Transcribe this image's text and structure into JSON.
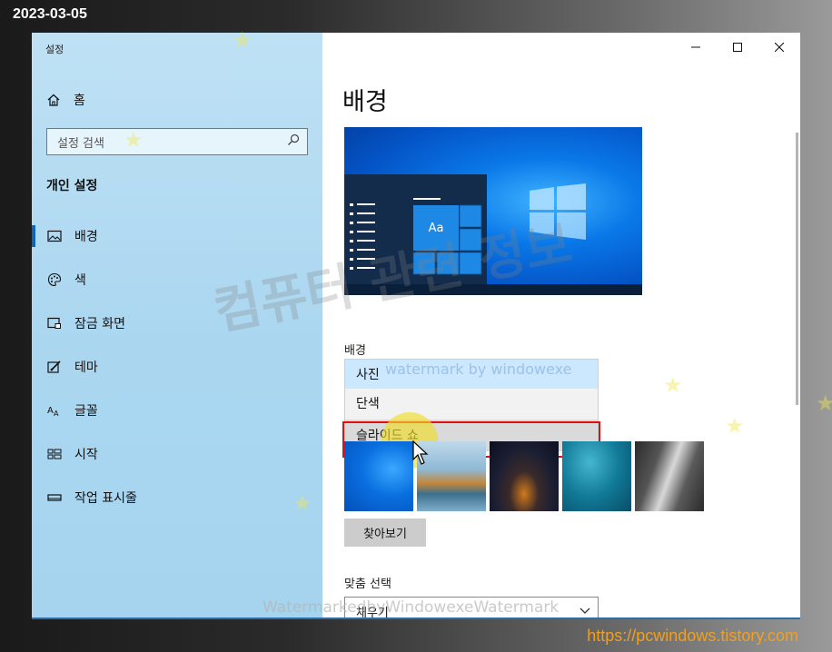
{
  "overlay": {
    "date": "2023-03-05",
    "url": "https://pcwindows.tistory.com",
    "watermark_big": "컴퓨터 관련 정보",
    "watermark_small": "watermark by windowexe",
    "watermark_bottom": "WatermarkedbyWindowexeWatermark"
  },
  "window": {
    "app_title": "설정",
    "controls": [
      "minimize",
      "maximize",
      "close"
    ]
  },
  "sidebar": {
    "home_label": "홈",
    "search_placeholder": "설정 검색",
    "section_title": "개인 설정",
    "items": [
      {
        "label": "배경",
        "icon": "picture-icon",
        "active": true
      },
      {
        "label": "색",
        "icon": "palette-icon",
        "active": false
      },
      {
        "label": "잠금 화면",
        "icon": "lock-screen-icon",
        "active": false
      },
      {
        "label": "테마",
        "icon": "theme-icon",
        "active": false
      },
      {
        "label": "글꼴",
        "icon": "font-icon",
        "active": false
      },
      {
        "label": "시작",
        "icon": "start-icon",
        "active": false
      },
      {
        "label": "작업 표시줄",
        "icon": "taskbar-icon",
        "active": false
      }
    ]
  },
  "main": {
    "page_title": "배경",
    "preview_tile_label": "Aa",
    "background_label": "배경",
    "background_options": [
      {
        "label": "사진",
        "selected": true
      },
      {
        "label": "단색",
        "selected": false
      },
      {
        "label": "슬라이드 쇼",
        "selected": false,
        "hover": true
      }
    ],
    "browse_button": "찾아보기",
    "fit_label": "맞춤 선택",
    "fit_value": "채우기"
  },
  "colors": {
    "accent": "#0a66b8",
    "highlight_box": "#e01010",
    "sidebar_bg": "#aad6f0",
    "dropdown_selected": "#cce8ff"
  }
}
